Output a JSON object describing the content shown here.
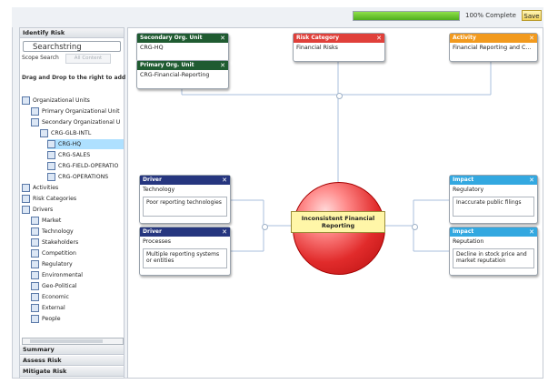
{
  "topbar": {
    "progress_label": "100% Complete",
    "progress_fraction": 1.0,
    "save_label": "Save"
  },
  "left": {
    "panel_title": "Identify Risk",
    "search_value": "Searchstring",
    "scope_label": "Scope Search",
    "scope_option": "All Content",
    "drag_note": "Drag and Drop to the right to add",
    "tree": [
      "Organizational Units",
      "Primary Organizational Unit",
      "Secondary Organizational U",
      "CRG-GLB-INTL",
      "CRG-HQ",
      "CRG-SALES",
      "CRG-FIELD-OPERATIO",
      "CRG-OPERATIONS",
      "Activities",
      "Risk Categories",
      "Drivers",
      "Market",
      "Technology",
      "Stakeholders",
      "Competition",
      "Regulatory",
      "Environmental",
      "Geo-Political",
      "Economic",
      "External",
      "People"
    ],
    "sections": [
      "Summary",
      "Assess Risk",
      "Mitigate Risk"
    ]
  },
  "cards": {
    "secondary": {
      "title": "Secondary Org. Unit",
      "value": "CRG-HQ"
    },
    "primary": {
      "title": "Primary Org. Unit",
      "value": "CRG-Financial-Reporting"
    },
    "riskcat": {
      "title": "Risk Category",
      "value": "Financial Risks"
    },
    "activity": {
      "title": "Activity",
      "value": "Financial Reporting and C..."
    },
    "driver1": {
      "title": "Driver",
      "value": "Technology",
      "detail": "Poor reporting technologies"
    },
    "driver2": {
      "title": "Driver",
      "value": "Processes",
      "detail": "Multiple reporting systems or entities"
    },
    "impact1": {
      "title": "Impact",
      "value": "Regulatory",
      "detail": "Inaccurate public filings"
    },
    "impact2": {
      "title": "Impact",
      "value": "Reputation",
      "detail": "Decline in stock price and market reputation"
    }
  },
  "close_glyph": "✕",
  "risk": {
    "label": "Inconsistent Financial Reporting"
  },
  "colors": {
    "green": "#1f5b31",
    "red": "#e0403a",
    "orange": "#f29a1e",
    "navy": "#26367f",
    "sky": "#33a8e0"
  }
}
